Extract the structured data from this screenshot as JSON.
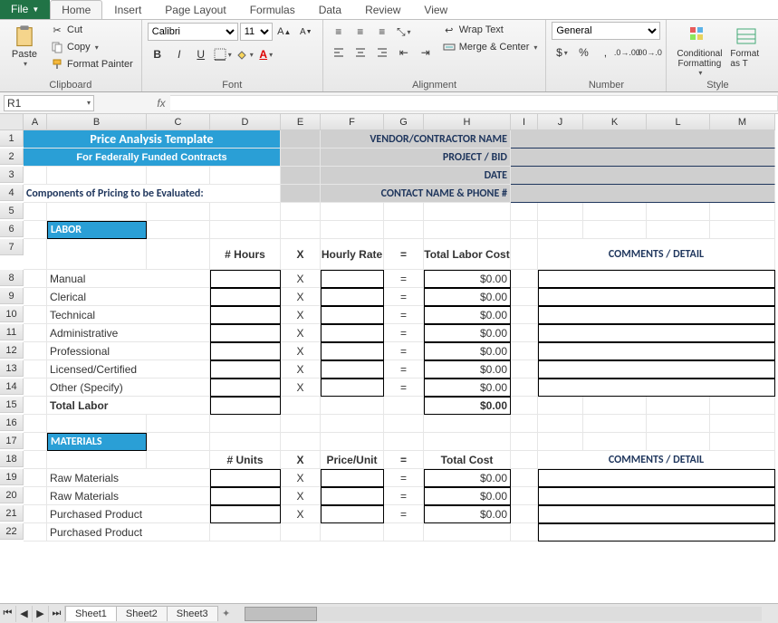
{
  "ribbon": {
    "file": "File",
    "tabs": [
      "Home",
      "Insert",
      "Page Layout",
      "Formulas",
      "Data",
      "Review",
      "View"
    ],
    "active_tab": "Home",
    "clipboard": {
      "paste": "Paste",
      "cut": "Cut",
      "copy": "Copy",
      "format_painter": "Format Painter",
      "label": "Clipboard"
    },
    "font": {
      "name": "Calibri",
      "size": "11",
      "label": "Font",
      "bold": "B",
      "italic": "I",
      "underline": "U",
      "inc": "A▴",
      "dec": "A▾"
    },
    "alignment": {
      "label": "Alignment",
      "wrap": "Wrap Text",
      "merge": "Merge & Center"
    },
    "number": {
      "label": "Number",
      "format": "General"
    },
    "styles_conditional": "Conditional Formatting",
    "styles_format_as": "Format as T",
    "styles_label": "Style"
  },
  "formula_bar": {
    "name_box": "R1",
    "fx": "fx",
    "value": ""
  },
  "columns": [
    "A",
    "B",
    "C",
    "D",
    "E",
    "F",
    "G",
    "H",
    "I",
    "J",
    "K",
    "L",
    "M"
  ],
  "rows_visible": 22,
  "sheet": {
    "title": "Price Analysis Template",
    "subtitle": "For Federally Funded Contracts",
    "components_hdr": "Components of Pricing to be Evaluated:",
    "contact_labels": [
      "VENDOR/CONTRACTOR NAME",
      "PROJECT / BID",
      "DATE",
      "CONTACT NAME & PHONE #"
    ],
    "labor_section": "LABOR",
    "labor_cols": {
      "hours": "# Hours",
      "x": "X",
      "rate": "Hourly Rate",
      "eq": "=",
      "total": "Total Labor Cost",
      "comments": "COMMENTS / DETAIL"
    },
    "labor_rows": [
      "Manual",
      "Clerical",
      "Technical",
      "Administrative",
      "Professional",
      "Licensed/Certified",
      "Other (Specify)"
    ],
    "labor_total_label": "Total Labor",
    "labor_totals": [
      "$0.00",
      "$0.00",
      "$0.00",
      "$0.00",
      "$0.00",
      "$0.00",
      "$0.00"
    ],
    "labor_grand_total": "$0.00",
    "materials_section": "MATERIALS",
    "mat_cols": {
      "units": "# Units",
      "x": "X",
      "price": "Price/Unit",
      "eq": "=",
      "total": "Total Cost",
      "comments": "COMMENTS / DETAIL"
    },
    "mat_rows": [
      "Raw Materials",
      "Raw Materials",
      "Purchased Product",
      "Purchased Product"
    ],
    "mat_totals": [
      "$0.00",
      "$0.00",
      "$0.00"
    ],
    "symbols": {
      "x": "X",
      "eq": "="
    }
  },
  "sheets": {
    "tabs": [
      "Sheet1",
      "Sheet2",
      "Sheet3"
    ],
    "active": "Sheet1"
  }
}
